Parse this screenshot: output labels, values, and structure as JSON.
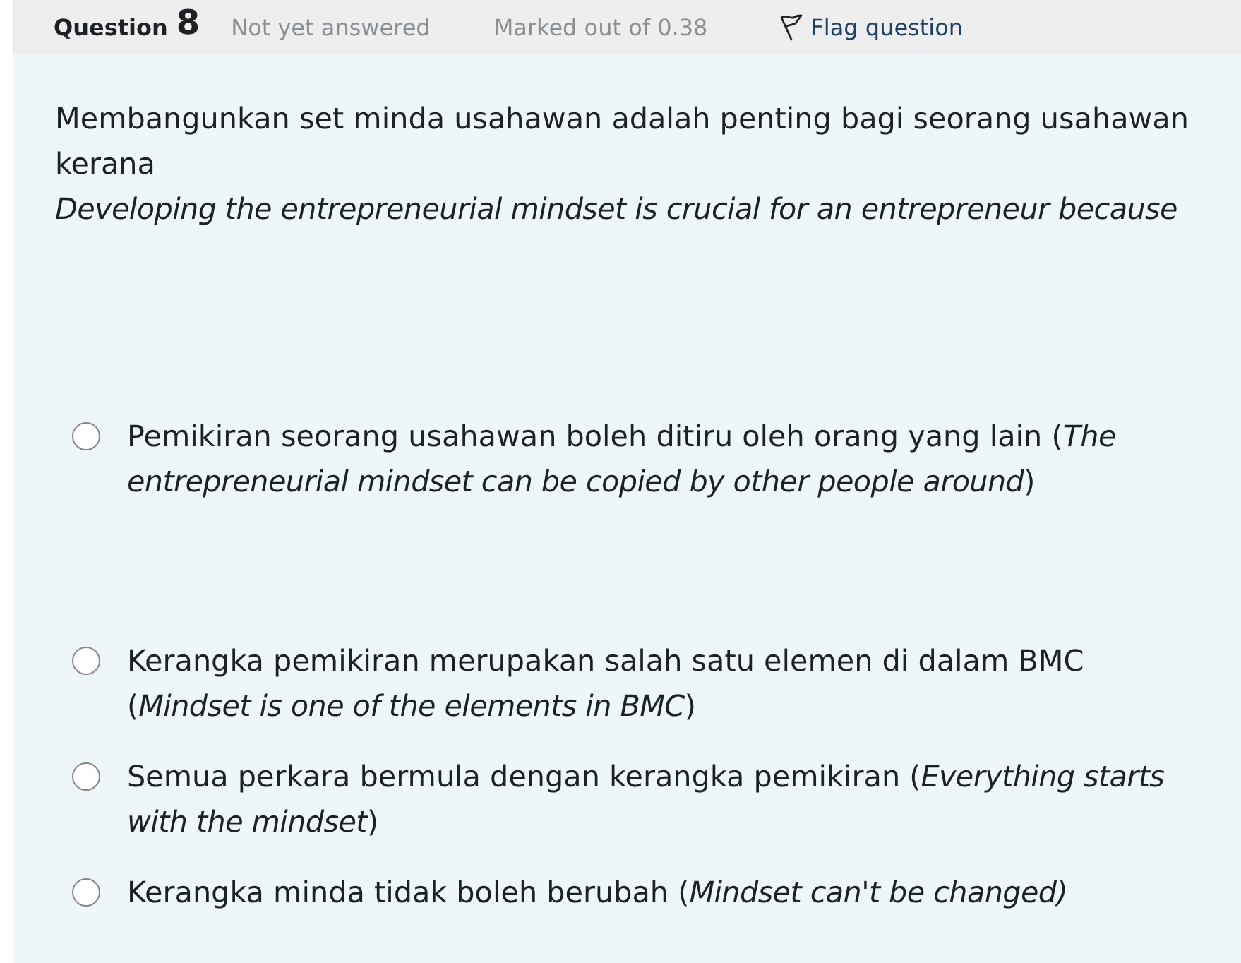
{
  "header": {
    "label": "Question",
    "number": "8",
    "state": "Not yet answered",
    "grade": "Marked out of 0.38",
    "flag": {
      "label": "Flag question",
      "flagged": false
    }
  },
  "question": {
    "prompt": "Membangunkan set minda usahawan adalah penting bagi seorang usahawan kerana",
    "translation": "Developing the entrepreneurial mindset is crucial for an entrepreneur because"
  },
  "options": [
    {
      "text": "Pemikiran seorang usahawan boleh ditiru oleh orang yang lain (*The entrepreneurial mindset can be copied by other people around*)",
      "selected": false
    },
    {
      "text": "Kerangka pemikiran merupakan salah satu elemen di dalam BMC (*Mindset is one of the elements in BMC*)",
      "selected": false
    },
    {
      "text": "Semua perkara bermula dengan kerangka pemikiran (*Everything starts with the mindset*)",
      "selected": false
    },
    {
      "text": "Kerangka minda tidak boleh berubah (*Mindset can't be changed)*",
      "selected": false
    }
  ]
}
